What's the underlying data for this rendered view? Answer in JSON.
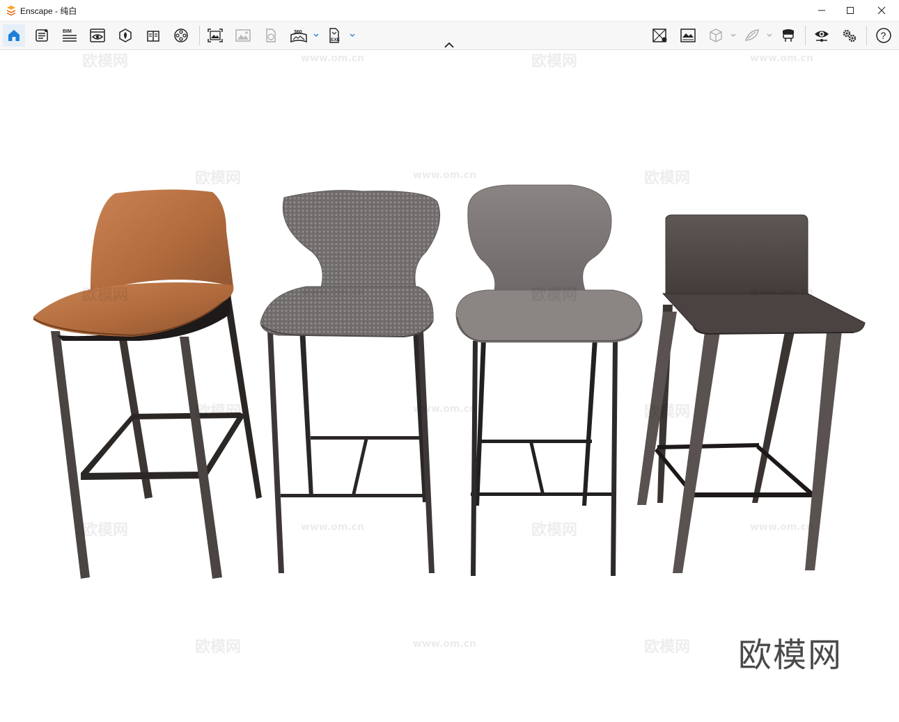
{
  "window": {
    "app_name": "Enscape",
    "separator": " - ",
    "scene_name": "纯白",
    "controls": [
      "minimize-icon",
      "maximize-icon",
      "close-icon"
    ]
  },
  "toolbar": {
    "left_icons": [
      "home-icon",
      "notes-icon",
      "bim-icon",
      "views-icon",
      "asset-library-icon",
      "material-editor-icon",
      "video-editor-icon",
      "screenshot-icon",
      "batch-render-icon",
      "web-export-icon",
      "panorama-360-icon",
      "exe-export-icon"
    ],
    "right_icons": [
      "minimap-icon",
      "atmosphere-icon",
      "cube-icon",
      "rendering-style-icon",
      "vr-headset-icon",
      "visual-settings-icon",
      "general-settings-icon",
      "help-icon"
    ],
    "bim_label": "BIM",
    "pano_label": "360",
    "exe_label": "EXE",
    "help_label": "?"
  },
  "viewport": {
    "watermark_logo": "欧模网",
    "watermark_url": "www.om.cn",
    "chairs": [
      "tan-leather-bar-stool",
      "hex-fabric-bar-stool",
      "grey-upholstered-bar-stool",
      "dark-leather-bar-stool"
    ]
  }
}
